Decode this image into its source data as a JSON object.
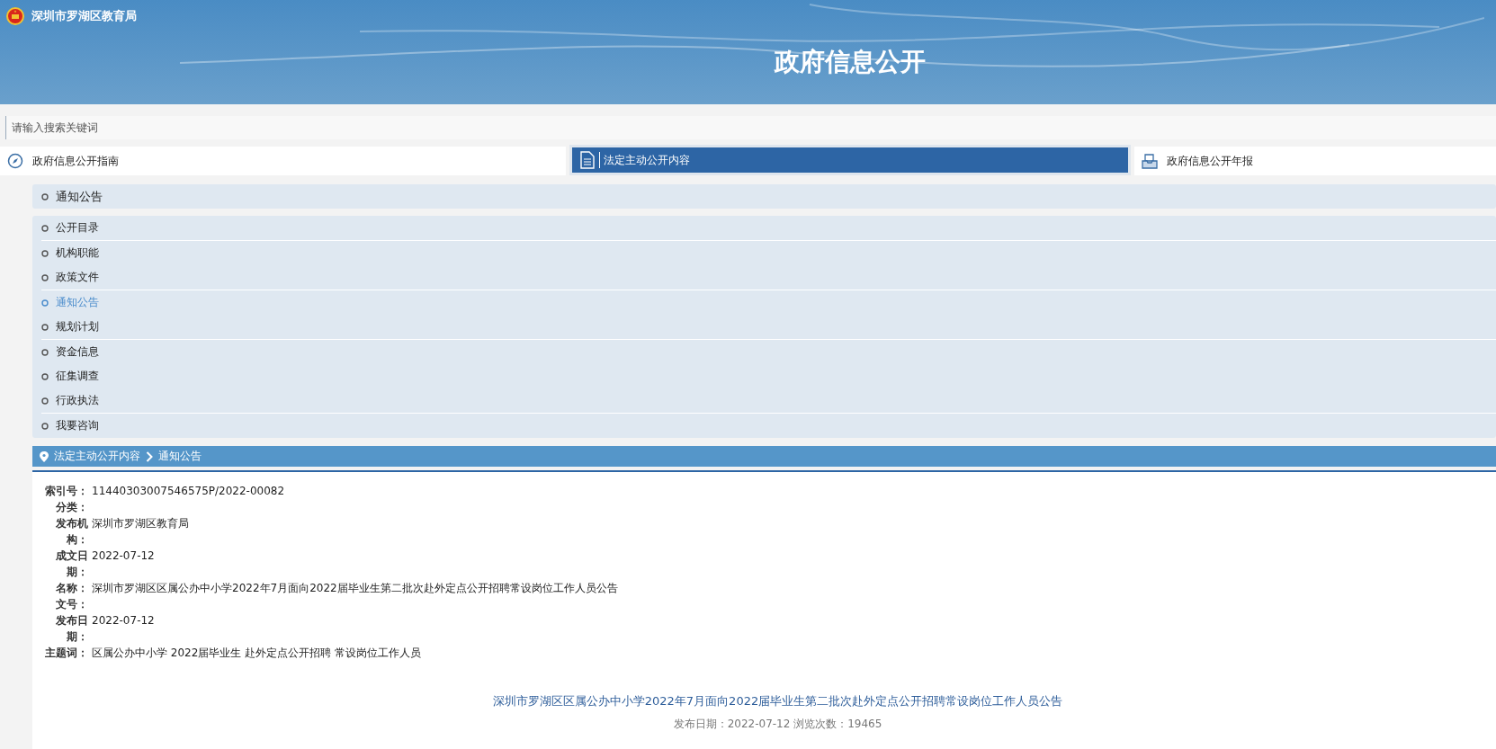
{
  "header": {
    "site_name": "深圳市罗湖区教育局",
    "title": "政府信息公开"
  },
  "search": {
    "placeholder": "请输入搜索关键词"
  },
  "tabs": [
    {
      "label": "政府信息公开指南",
      "selected": false
    },
    {
      "label": "法定主动公开内容",
      "selected": true
    },
    {
      "label": "政府信息公开年报",
      "selected": false
    }
  ],
  "section": {
    "label": "通知公告"
  },
  "menu": {
    "groups": [
      {
        "items": [
          {
            "label": "公开目录",
            "selected": false
          }
        ]
      },
      {
        "items": [
          {
            "label": "机构职能",
            "selected": false
          },
          {
            "label": "政策文件",
            "selected": false
          }
        ]
      },
      {
        "items": [
          {
            "label": "通知公告",
            "selected": true
          },
          {
            "label": "规划计划",
            "selected": false
          }
        ]
      },
      {
        "items": [
          {
            "label": "资金信息",
            "selected": false
          },
          {
            "label": "征集调查",
            "selected": false
          },
          {
            "label": "行政执法",
            "selected": false
          }
        ]
      },
      {
        "items": [
          {
            "label": "我要咨询",
            "selected": false
          }
        ]
      }
    ]
  },
  "breadcrumb": [
    "法定主动公开内容",
    "通知公告"
  ],
  "details": [
    {
      "label": "索引号：",
      "value": "11440303007546575P/2022-00082"
    },
    {
      "label": "分类："
    },
    {
      "label": "发布机构：",
      "value": "深圳市罗湖区教育局"
    },
    {
      "label": "成文日期：",
      "value": "2022-07-12"
    },
    {
      "label": "名称：",
      "value": "深圳市罗湖区区属公办中小学2022年7月面向2022届毕业生第二批次赴外定点公开招聘常设岗位工作人员公告"
    },
    {
      "label": "文号："
    },
    {
      "label": "发布日期：",
      "value": "2022-07-12"
    },
    {
      "label": "主题词：",
      "value": "区属公办中小学 2022届毕业生 赴外定点公开招聘 常设岗位工作人员"
    }
  ],
  "article": {
    "title": "深圳市罗湖区区属公办中小学2022年7月面向2022届毕业生第二批次赴外定点公开招聘常设岗位工作人员公告",
    "meta": "发布日期：2022-07-12  浏览次数：19465"
  }
}
